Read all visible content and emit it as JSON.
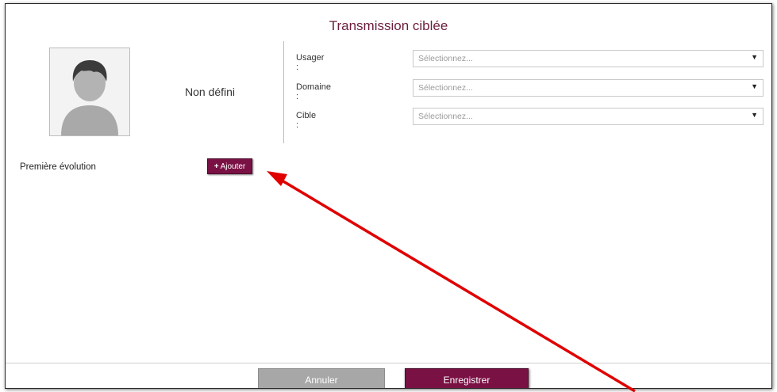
{
  "dialog": {
    "title": "Transmission ciblée"
  },
  "patient": {
    "name": "Non défini",
    "avatar_icon": "user-placeholder-icon"
  },
  "form": {
    "fields": [
      {
        "label": "Usager :",
        "placeholder": "Sélectionnez..."
      },
      {
        "label": "Domaine :",
        "placeholder": "Sélectionnez..."
      },
      {
        "label": "Cible :",
        "placeholder": "Sélectionnez..."
      }
    ]
  },
  "evolution": {
    "label": "Première évolution",
    "add_button": "Ajouter",
    "add_icon": "plus-icon"
  },
  "footer": {
    "cancel_label": "Annuler",
    "save_label": "Enregistrer"
  },
  "annotation": {
    "arrow_color": "#e00000"
  },
  "colors": {
    "accent": "#7a1145",
    "title": "#6b1e3a",
    "disabled": "#a7a7a7"
  }
}
